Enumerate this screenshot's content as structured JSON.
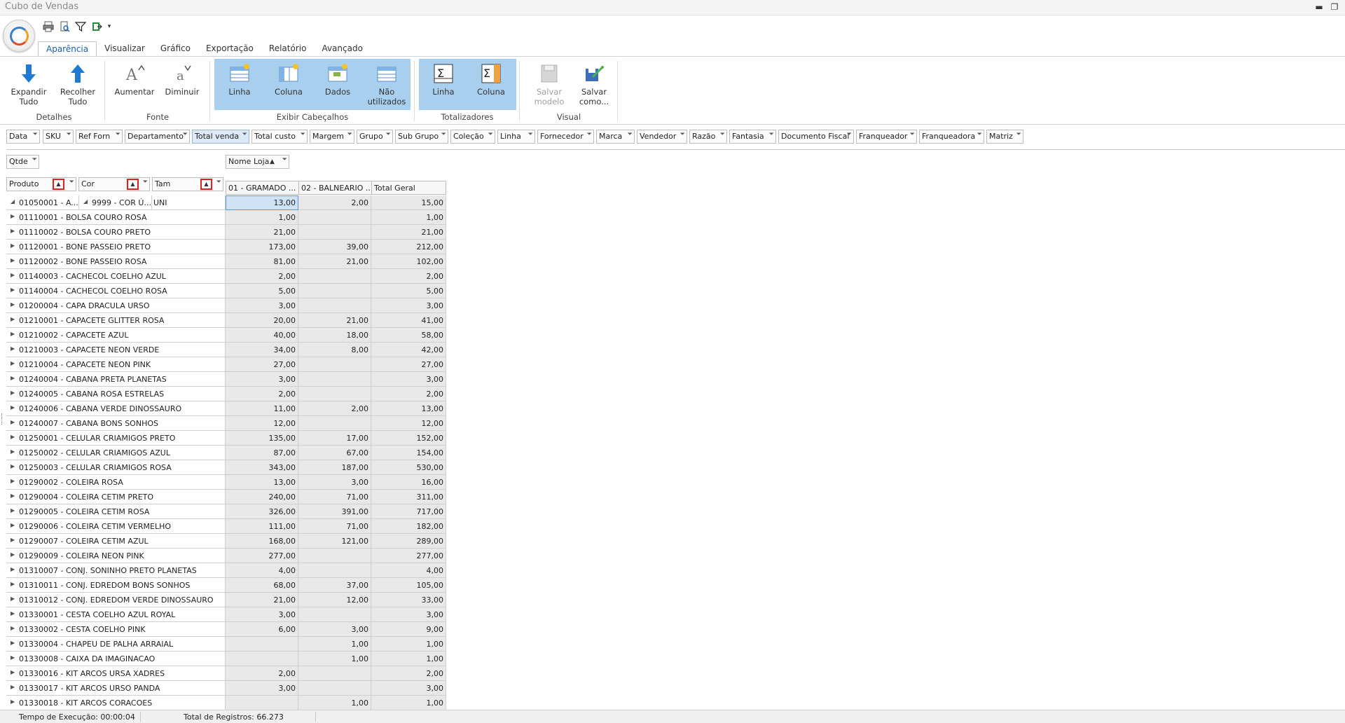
{
  "window": {
    "title": "Cubo de Vendas",
    "min_label": "▬",
    "restore_label": "❐"
  },
  "qat": [
    "print-icon",
    "print-preview-icon",
    "filter-icon",
    "export-icon",
    "customize-icon"
  ],
  "tabs": [
    "Aparência",
    "Visualizar",
    "Gráfico",
    "Exportação",
    "Relatório",
    "Avançado"
  ],
  "ribbon": {
    "groups": {
      "detalhes": "Detalhes",
      "fonte": "Fonte",
      "cabecalhos": "Exibir Cabeçalhos",
      "totalizadores": "Totalizadores",
      "visual": "Visual"
    },
    "buttons": {
      "expandir": [
        "Expandir",
        "Tudo"
      ],
      "recolher": [
        "Recolher",
        "Tudo"
      ],
      "aumentar": "Aumentar",
      "diminuir": "Diminuir",
      "linha": "Linha",
      "coluna": "Coluna",
      "dados": "Dados",
      "nao_utilizados": [
        "Não",
        "utilizados"
      ],
      "tot_linha": "Linha",
      "tot_coluna": "Coluna",
      "salvar_modelo": [
        "Salvar",
        "modelo"
      ],
      "salvar_como": [
        "Salvar",
        "como..."
      ]
    }
  },
  "filter_fields": [
    "Data",
    "SKU",
    "Ref Forn",
    "Departamento",
    "Total venda",
    "Total custo",
    "Margem",
    "Grupo",
    "Sub Grupo",
    "Coleção",
    "Linha",
    "Fornecedor",
    "Marca",
    "Vendedor",
    "Razão",
    "Fantasia",
    "Documento Fiscal",
    "Franqueador",
    "Franqueadora",
    "Matriz"
  ],
  "data_field": "Qtde",
  "column_field": "Nome Loja",
  "row_fields": [
    "Produto",
    "Cor",
    "Tam"
  ],
  "columns": [
    "01 - GRAMADO ...",
    "02 - BALNEARIO ...",
    "Total Geral"
  ],
  "first_row": {
    "produto": "01050001 - A...",
    "cor": "9999 - COR Ú...",
    "tam": "UNI",
    "v1": "13,00",
    "v2": "2,00",
    "total": "15,00"
  },
  "rows": [
    {
      "name": "01110001 - BOLSA COURO ROSA",
      "v1": "1,00",
      "v2": "",
      "total": "1,00"
    },
    {
      "name": "01110002 - BOLSA COURO PRETO",
      "v1": "21,00",
      "v2": "",
      "total": "21,00"
    },
    {
      "name": "01120001 - BONE PASSEIO PRETO",
      "v1": "173,00",
      "v2": "39,00",
      "total": "212,00"
    },
    {
      "name": "01120002 - BONE PASSEIO ROSA",
      "v1": "81,00",
      "v2": "21,00",
      "total": "102,00"
    },
    {
      "name": "01140003 - CACHECOL COELHO AZUL",
      "v1": "2,00",
      "v2": "",
      "total": "2,00"
    },
    {
      "name": "01140004 - CACHECOL COELHO ROSA",
      "v1": "5,00",
      "v2": "",
      "total": "5,00"
    },
    {
      "name": "01200004 - CAPA DRACULA URSO",
      "v1": "3,00",
      "v2": "",
      "total": "3,00"
    },
    {
      "name": "01210001 - CAPACETE GLITTER ROSA",
      "v1": "20,00",
      "v2": "21,00",
      "total": "41,00"
    },
    {
      "name": "01210002 - CAPACETE AZUL",
      "v1": "40,00",
      "v2": "18,00",
      "total": "58,00"
    },
    {
      "name": "01210003 - CAPACETE NEON VERDE",
      "v1": "34,00",
      "v2": "8,00",
      "total": "42,00"
    },
    {
      "name": "01210004 - CAPACETE NEON PINK",
      "v1": "27,00",
      "v2": "",
      "total": "27,00"
    },
    {
      "name": "01240004 - CABANA PRETA PLANETAS",
      "v1": "3,00",
      "v2": "",
      "total": "3,00"
    },
    {
      "name": "01240005 - CABANA ROSA ESTRELAS",
      "v1": "2,00",
      "v2": "",
      "total": "2,00"
    },
    {
      "name": "01240006 - CABANA VERDE DINOSSAURO",
      "v1": "11,00",
      "v2": "2,00",
      "total": "13,00"
    },
    {
      "name": "01240007 - CABANA BONS SONHOS",
      "v1": "12,00",
      "v2": "",
      "total": "12,00"
    },
    {
      "name": "01250001 - CELULAR CRIAMIGOS PRETO",
      "v1": "135,00",
      "v2": "17,00",
      "total": "152,00"
    },
    {
      "name": "01250002 - CELULAR CRIAMIGOS AZUL",
      "v1": "87,00",
      "v2": "67,00",
      "total": "154,00"
    },
    {
      "name": "01250003 - CELULAR CRIAMIGOS ROSA",
      "v1": "343,00",
      "v2": "187,00",
      "total": "530,00"
    },
    {
      "name": "01290002 - COLEIRA ROSA",
      "v1": "13,00",
      "v2": "3,00",
      "total": "16,00"
    },
    {
      "name": "01290004 - COLEIRA CETIM PRETO",
      "v1": "240,00",
      "v2": "71,00",
      "total": "311,00"
    },
    {
      "name": "01290005 - COLEIRA CETIM ROSA",
      "v1": "326,00",
      "v2": "391,00",
      "total": "717,00"
    },
    {
      "name": "01290006 - COLEIRA CETIM VERMELHO",
      "v1": "111,00",
      "v2": "71,00",
      "total": "182,00"
    },
    {
      "name": "01290007 - COLEIRA CETIM AZUL",
      "v1": "168,00",
      "v2": "121,00",
      "total": "289,00"
    },
    {
      "name": "01290009 - COLEIRA NEON PINK",
      "v1": "277,00",
      "v2": "",
      "total": "277,00"
    },
    {
      "name": "01310007 - CONJ. SONINHO PRETO PLANETAS",
      "v1": "4,00",
      "v2": "",
      "total": "4,00"
    },
    {
      "name": "01310011 - CONJ. EDREDOM BONS SONHOS",
      "v1": "68,00",
      "v2": "37,00",
      "total": "105,00"
    },
    {
      "name": "01310012 - CONJ. EDREDOM VERDE DINOSSAURO",
      "v1": "21,00",
      "v2": "12,00",
      "total": "33,00"
    },
    {
      "name": "01330001 - CESTA COELHO AZUL ROYAL",
      "v1": "3,00",
      "v2": "",
      "total": "3,00"
    },
    {
      "name": "01330002 - CESTA COELHO PINK",
      "v1": "6,00",
      "v2": "3,00",
      "total": "9,00"
    },
    {
      "name": "01330004 - CHAPEU DE PALHA ARRAIAL",
      "v1": "",
      "v2": "1,00",
      "total": "1,00"
    },
    {
      "name": "01330008 - CAIXA DA IMAGINACAO",
      "v1": "",
      "v2": "1,00",
      "total": "1,00"
    },
    {
      "name": "01330016 - KIT ARCOS URSA XADRES",
      "v1": "2,00",
      "v2": "",
      "total": "2,00"
    },
    {
      "name": "01330017 - KIT ARCOS URSO PANDA",
      "v1": "3,00",
      "v2": "",
      "total": "3,00"
    },
    {
      "name": "01330018 - KIT ARCOS CORACOES",
      "v1": "",
      "v2": "1,00",
      "total": "1,00"
    }
  ],
  "status": {
    "tempo": "Tempo de Execução: 00:00:04",
    "registros": "Total de Registros: 66.273"
  },
  "colors": {
    "accent": "#1e5fa8",
    "ribbon_selected": "#a9cfee",
    "sort_box": "#e0211b",
    "cell_bg": "#e8e8e8"
  }
}
